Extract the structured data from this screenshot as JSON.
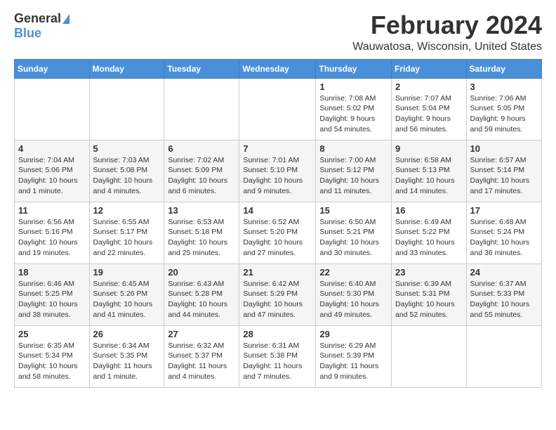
{
  "logo": {
    "general": "General",
    "blue": "Blue"
  },
  "title": {
    "month_year": "February 2024",
    "location": "Wauwatosa, Wisconsin, United States"
  },
  "weekdays": [
    "Sunday",
    "Monday",
    "Tuesday",
    "Wednesday",
    "Thursday",
    "Friday",
    "Saturday"
  ],
  "weeks": [
    [
      {
        "day": "",
        "info": ""
      },
      {
        "day": "",
        "info": ""
      },
      {
        "day": "",
        "info": ""
      },
      {
        "day": "",
        "info": ""
      },
      {
        "day": "1",
        "info": "Sunrise: 7:08 AM\nSunset: 5:02 PM\nDaylight: 9 hours and 54 minutes."
      },
      {
        "day": "2",
        "info": "Sunrise: 7:07 AM\nSunset: 5:04 PM\nDaylight: 9 hours and 56 minutes."
      },
      {
        "day": "3",
        "info": "Sunrise: 7:06 AM\nSunset: 5:05 PM\nDaylight: 9 hours and 59 minutes."
      }
    ],
    [
      {
        "day": "4",
        "info": "Sunrise: 7:04 AM\nSunset: 5:06 PM\nDaylight: 10 hours and 1 minute."
      },
      {
        "day": "5",
        "info": "Sunrise: 7:03 AM\nSunset: 5:08 PM\nDaylight: 10 hours and 4 minutes."
      },
      {
        "day": "6",
        "info": "Sunrise: 7:02 AM\nSunset: 5:09 PM\nDaylight: 10 hours and 6 minutes."
      },
      {
        "day": "7",
        "info": "Sunrise: 7:01 AM\nSunset: 5:10 PM\nDaylight: 10 hours and 9 minutes."
      },
      {
        "day": "8",
        "info": "Sunrise: 7:00 AM\nSunset: 5:12 PM\nDaylight: 10 hours and 11 minutes."
      },
      {
        "day": "9",
        "info": "Sunrise: 6:58 AM\nSunset: 5:13 PM\nDaylight: 10 hours and 14 minutes."
      },
      {
        "day": "10",
        "info": "Sunrise: 6:57 AM\nSunset: 5:14 PM\nDaylight: 10 hours and 17 minutes."
      }
    ],
    [
      {
        "day": "11",
        "info": "Sunrise: 6:56 AM\nSunset: 5:16 PM\nDaylight: 10 hours and 19 minutes."
      },
      {
        "day": "12",
        "info": "Sunrise: 6:55 AM\nSunset: 5:17 PM\nDaylight: 10 hours and 22 minutes."
      },
      {
        "day": "13",
        "info": "Sunrise: 6:53 AM\nSunset: 5:18 PM\nDaylight: 10 hours and 25 minutes."
      },
      {
        "day": "14",
        "info": "Sunrise: 6:52 AM\nSunset: 5:20 PM\nDaylight: 10 hours and 27 minutes."
      },
      {
        "day": "15",
        "info": "Sunrise: 6:50 AM\nSunset: 5:21 PM\nDaylight: 10 hours and 30 minutes."
      },
      {
        "day": "16",
        "info": "Sunrise: 6:49 AM\nSunset: 5:22 PM\nDaylight: 10 hours and 33 minutes."
      },
      {
        "day": "17",
        "info": "Sunrise: 6:48 AM\nSunset: 5:24 PM\nDaylight: 10 hours and 36 minutes."
      }
    ],
    [
      {
        "day": "18",
        "info": "Sunrise: 6:46 AM\nSunset: 5:25 PM\nDaylight: 10 hours and 38 minutes."
      },
      {
        "day": "19",
        "info": "Sunrise: 6:45 AM\nSunset: 5:26 PM\nDaylight: 10 hours and 41 minutes."
      },
      {
        "day": "20",
        "info": "Sunrise: 6:43 AM\nSunset: 5:28 PM\nDaylight: 10 hours and 44 minutes."
      },
      {
        "day": "21",
        "info": "Sunrise: 6:42 AM\nSunset: 5:29 PM\nDaylight: 10 hours and 47 minutes."
      },
      {
        "day": "22",
        "info": "Sunrise: 6:40 AM\nSunset: 5:30 PM\nDaylight: 10 hours and 49 minutes."
      },
      {
        "day": "23",
        "info": "Sunrise: 6:39 AM\nSunset: 5:31 PM\nDaylight: 10 hours and 52 minutes."
      },
      {
        "day": "24",
        "info": "Sunrise: 6:37 AM\nSunset: 5:33 PM\nDaylight: 10 hours and 55 minutes."
      }
    ],
    [
      {
        "day": "25",
        "info": "Sunrise: 6:35 AM\nSunset: 5:34 PM\nDaylight: 10 hours and 58 minutes."
      },
      {
        "day": "26",
        "info": "Sunrise: 6:34 AM\nSunset: 5:35 PM\nDaylight: 11 hours and 1 minute."
      },
      {
        "day": "27",
        "info": "Sunrise: 6:32 AM\nSunset: 5:37 PM\nDaylight: 11 hours and 4 minutes."
      },
      {
        "day": "28",
        "info": "Sunrise: 6:31 AM\nSunset: 5:38 PM\nDaylight: 11 hours and 7 minutes."
      },
      {
        "day": "29",
        "info": "Sunrise: 6:29 AM\nSunset: 5:39 PM\nDaylight: 11 hours and 9 minutes."
      },
      {
        "day": "",
        "info": ""
      },
      {
        "day": "",
        "info": ""
      }
    ]
  ]
}
